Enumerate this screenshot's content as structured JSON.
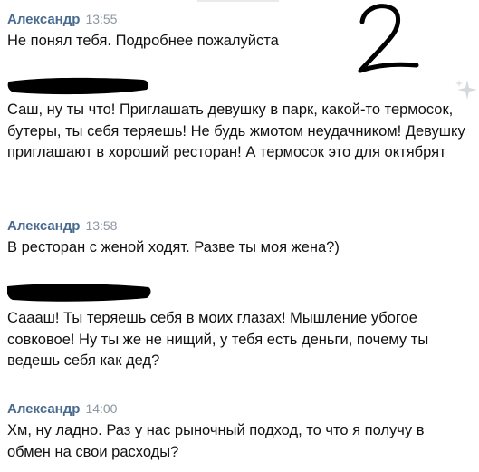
{
  "messages": [
    {
      "author": "Александр",
      "time": "13:55",
      "text": "Не понял тебя. Подробнее пожалуйста"
    },
    {
      "author": "",
      "time": "",
      "text": "Саш, ну ты что! Приглашать девушку в парк, какой-то термосок, бутеры, ты себя теряешь! Не будь жмотом неудачником! Девушку приглашают в хороший ресторан! А термосок это для октябрят"
    },
    {
      "author": "Александр",
      "time": "13:58",
      "text": "В ресторан с женой ходят. Разве ты моя жена?)"
    },
    {
      "author": "",
      "time": "",
      "text": "Сааaш! Ты теряешь себя в моих глазах! Мышление убогое совковое! Ну ты же не нищий, у тебя есть деньги, почему ты ведешь себя как дед?"
    },
    {
      "author": "Александр",
      "time": "14:00",
      "text": "Хм, ну ладно. Раз у нас рыночный подход, то что я получу в обмен на свои расходы?"
    }
  ],
  "annotation": {
    "handwritten": "2"
  },
  "icons": {
    "sparkle": "sparkle-icon"
  },
  "colors": {
    "author": "#4a6b8f",
    "time": "#8c97a3",
    "redaction": "#000000"
  }
}
